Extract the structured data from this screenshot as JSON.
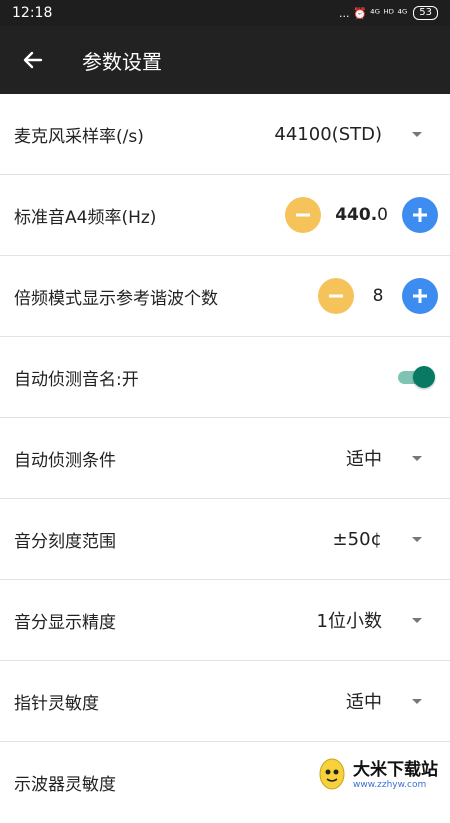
{
  "status_bar": {
    "time": "12:18",
    "indicators": "... ⏰ ⁴ᴳ ᴴᴰ ⁴ᴳ",
    "battery": "53"
  },
  "app_bar": {
    "back_icon": "arrow-left-icon",
    "title": "参数设置"
  },
  "settings": {
    "sample_rate": {
      "label": "麦克风采样率(/s)",
      "value": "44100(STD)"
    },
    "a4_freq": {
      "label": "标准音A4频率(Hz)",
      "value_int": "440.",
      "value_dec": "0"
    },
    "harmonics": {
      "label": "倍频模式显示参考谐波个数",
      "value": "8"
    },
    "auto_detect_name": {
      "label": "自动侦测音名:开",
      "on": true
    },
    "auto_detect_cond": {
      "label": "自动侦测条件",
      "value": "适中"
    },
    "cent_range": {
      "label": "音分刻度范围",
      "value": "±50¢"
    },
    "cent_precision": {
      "label": "音分显示精度",
      "value": "1位小数"
    },
    "needle_sensitivity": {
      "label": "指针灵敏度",
      "value": "适中"
    },
    "scope_sensitivity": {
      "label": "示波器灵敏度"
    }
  },
  "colors": {
    "minus_button": "#f6c35a",
    "plus_button": "#3d8cf0",
    "toggle_on": "#087a63"
  },
  "watermark": {
    "title": "大米下载站",
    "url": "www.zzhyw.com"
  }
}
